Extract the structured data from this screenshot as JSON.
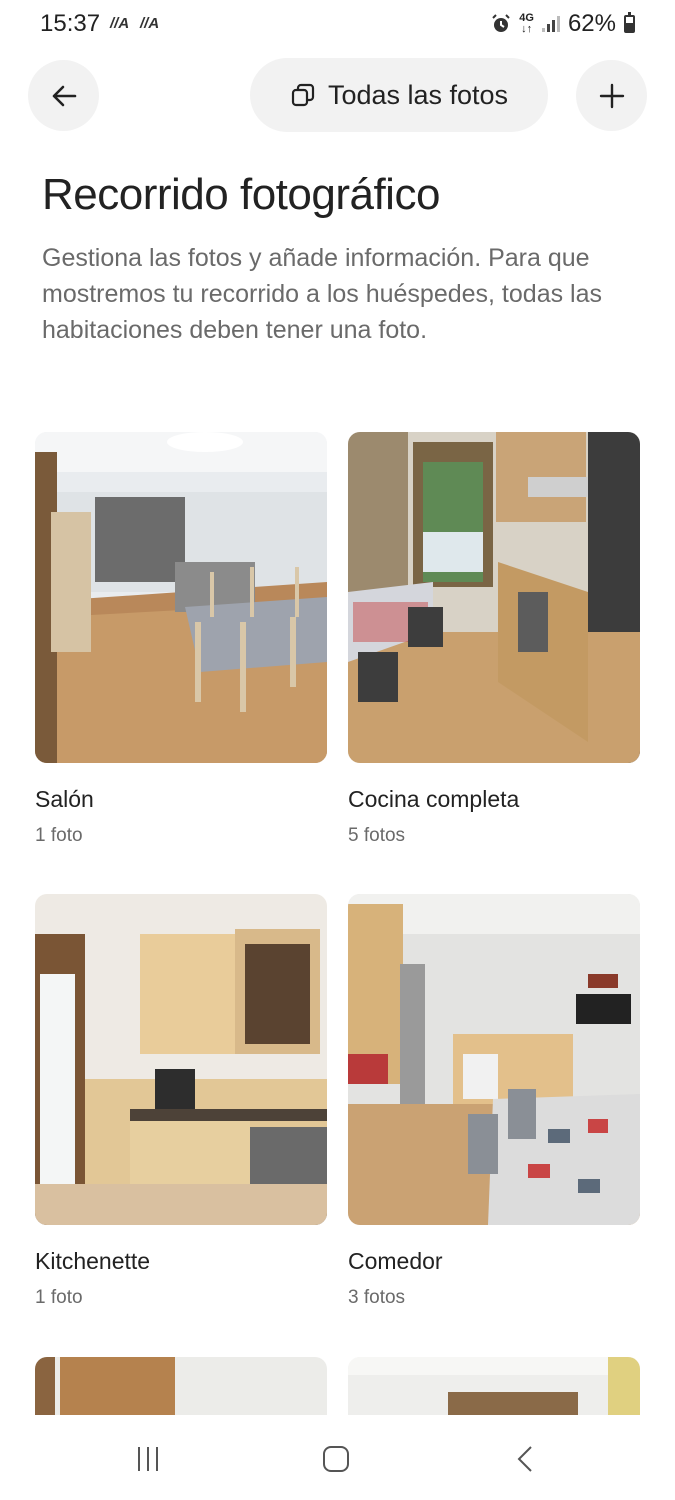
{
  "status_bar": {
    "time": "15:37",
    "net_a1": "//A",
    "net_a2": "//A",
    "net_type_top": "4G",
    "net_type_bottom": "↓↑",
    "battery": "62%"
  },
  "header": {
    "all_photos_label": "Todas las fotos"
  },
  "page": {
    "title": "Recorrido fotográfico",
    "description": "Gestiona las fotos y añade información. Para que mostremos tu recorrido a los huéspedes, todas las habitaciones deben tener una foto."
  },
  "rooms": [
    {
      "name": "Salón",
      "count": "1 foto"
    },
    {
      "name": "Cocina completa",
      "count": "5 fotos"
    },
    {
      "name": "Kitchenette",
      "count": "1 foto"
    },
    {
      "name": "Comedor",
      "count": "3 fotos"
    }
  ],
  "icons": {
    "back": "arrow-left-icon",
    "photos": "photo-stack-icon",
    "add": "plus-icon",
    "nav_recents": "recents-icon",
    "nav_home": "home-icon",
    "nav_back": "chevron-left-icon"
  },
  "colors": {
    "text_primary": "#222222",
    "text_secondary": "#6a6a6a",
    "button_bg": "#f2f2f2"
  }
}
